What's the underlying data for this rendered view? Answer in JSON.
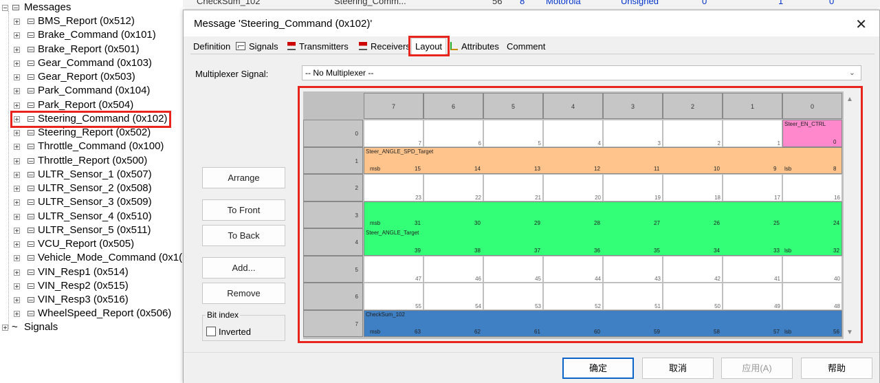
{
  "tree": {
    "root_label": "Messages",
    "items": [
      "BMS_Report (0x512)",
      "Brake_Command (0x101)",
      "Brake_Report (0x501)",
      "Gear_Command (0x103)",
      "Gear_Report (0x503)",
      "Park_Command (0x104)",
      "Park_Report (0x504)",
      "Steering_Command (0x102)",
      "Steering_Report (0x502)",
      "Throttle_Command (0x100)",
      "Throttle_Report (0x500)",
      "ULTR_Sensor_1 (0x507)",
      "ULTR_Sensor_2 (0x508)",
      "ULTR_Sensor_3 (0x509)",
      "ULTR_Sensor_4 (0x510)",
      "ULTR_Sensor_5 (0x511)",
      "VCU_Report (0x505)",
      "Vehicle_Mode_Command (0x1(",
      "VIN_Resp1 (0x514)",
      "VIN_Resp2 (0x515)",
      "VIN_Resp3 (0x516)",
      "WheelSpeed_Report (0x506)"
    ],
    "signals_label": "Signals",
    "selected_item": "Steering_Command (0x102)"
  },
  "background_row": {
    "name": "CheckSum_102",
    "message": "Steering_Comm...",
    "start": "56",
    "length": "8",
    "byte_order": "Motorola",
    "value_type": "Unsigned",
    "initial": "0",
    "factor": "1",
    "offset": "0"
  },
  "dialog": {
    "title": "Message 'Steering_Command (0x102)'",
    "close_glyph": "✕",
    "tabs": [
      "Definition",
      "Signals",
      "Transmitters",
      "Receivers",
      "Layout",
      "Attributes",
      "Comment"
    ],
    "active_tab": "Layout",
    "multiplexer_label": "Multiplexer Signal:",
    "multiplexer_value": "-- No Multiplexer --",
    "buttons": {
      "arrange": "Arrange",
      "to_front": "To Front",
      "to_back": "To Back",
      "add": "Add...",
      "remove": "Remove"
    },
    "bit_index_group": "Bit index",
    "inverted_label": "Inverted",
    "footer": {
      "ok": "确定",
      "cancel": "取消",
      "apply": "应用(A)",
      "help": "帮助"
    }
  },
  "layout_grid": {
    "column_headers": [
      "7",
      "6",
      "5",
      "4",
      "3",
      "2",
      "1",
      "0"
    ],
    "row_headers": [
      "0",
      "1",
      "2",
      "3",
      "4",
      "5",
      "6",
      "7"
    ],
    "signals": [
      {
        "name": "Steer_EN_CTRL",
        "color": "#ff88cc",
        "row": 0,
        "col_from": 7,
        "col_to": 7
      },
      {
        "name": "Steer_ANGLE_SPD_Target",
        "color": "#ffc48c",
        "row": 1,
        "col_from": 0,
        "col_to": 7,
        "msb": "msb",
        "lsb": "lsb"
      },
      {
        "name": "Steer_ANGLE_Target",
        "color": "#33ff77",
        "row": 3,
        "col_from": 0,
        "col_to": 7,
        "row_span": 2,
        "msb": "msb",
        "lsb": "lsb"
      },
      {
        "name": "CheckSum_102",
        "color": "#3f7fc4",
        "row": 7,
        "col_from": 0,
        "col_to": 7,
        "msb": "msb",
        "lsb": "lsb"
      }
    ]
  }
}
